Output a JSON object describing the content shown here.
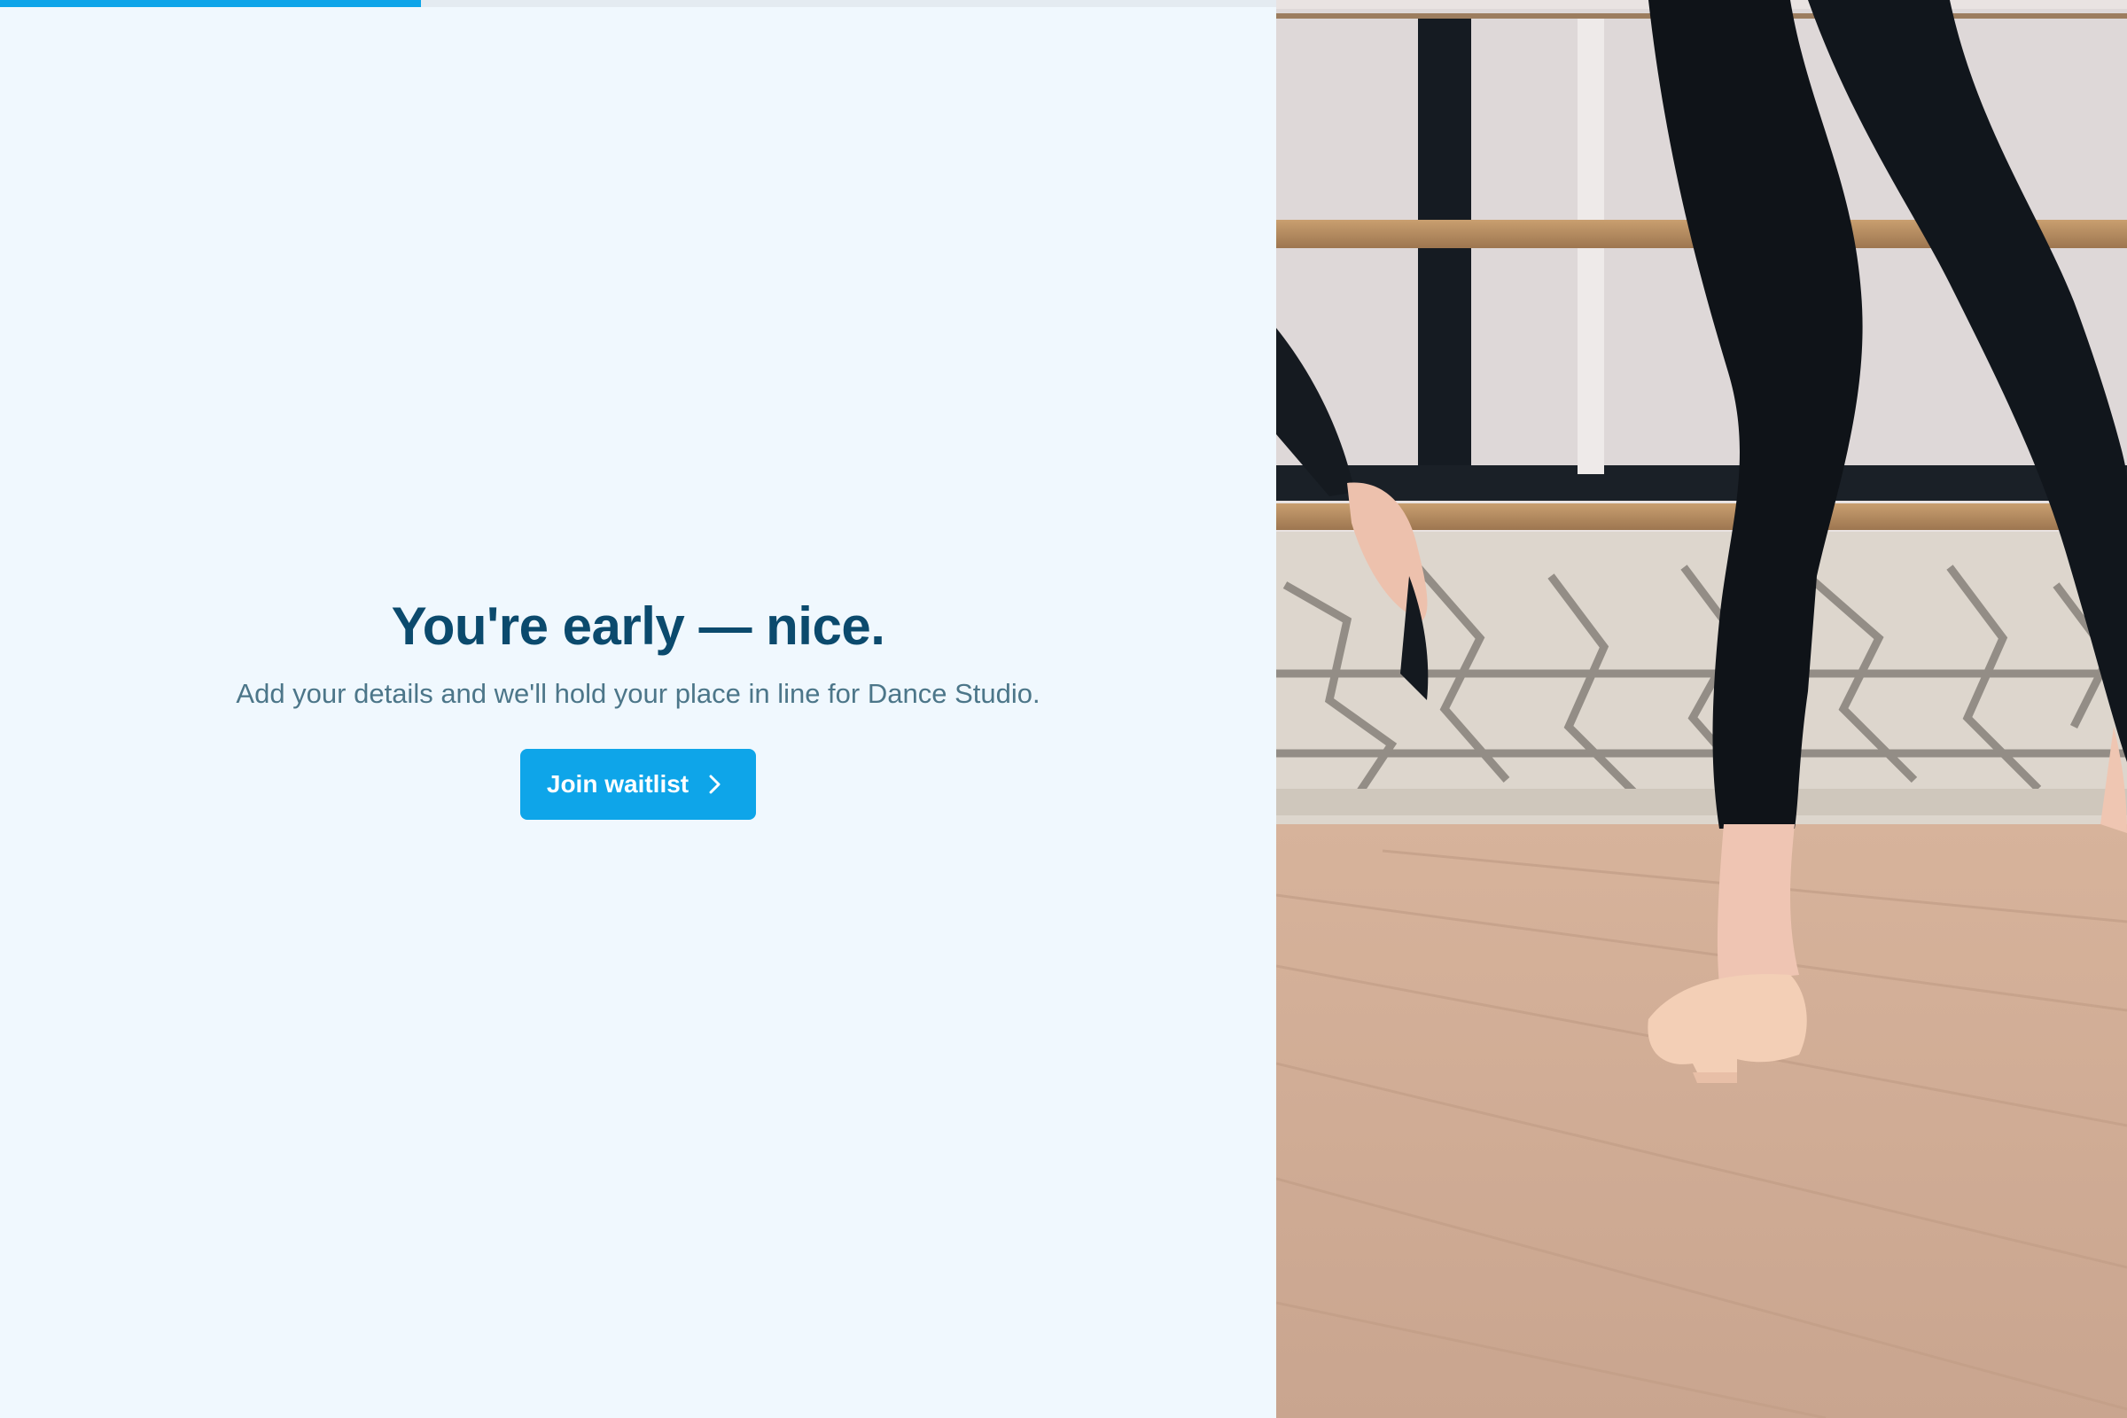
{
  "progress": {
    "value": 0.33
  },
  "hero": {
    "title": "You're early — nice.",
    "subtitle": "Add your details and we'll hold your place in line for Dance Studio.",
    "cta_label": "Join waitlist",
    "cta_icon": "chevron-right-icon"
  },
  "colors": {
    "accent": "#0ea5e9",
    "title": "#0b4a6d",
    "subtitle": "#4c7689",
    "background": "#f0f8fe"
  }
}
